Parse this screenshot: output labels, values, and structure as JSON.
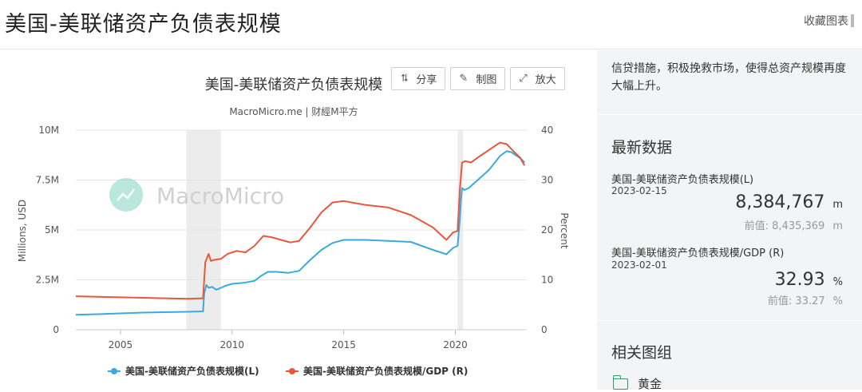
{
  "header": {
    "title": "美国-美联储资产负债表规模",
    "favorite_label": "收藏图表"
  },
  "toolbar": {
    "share_label": "分享",
    "draw_label": "制图",
    "zoom_label": "放大"
  },
  "watermark": "MacroMicro",
  "colors": {
    "series_l": "#3aa9dc",
    "series_r": "#e8573c",
    "recession": "#ececec"
  },
  "sidebar": {
    "intro_text": "信贷措施，积极挽救市场，使得总资产规模再度大幅上升。",
    "latest_title": "最新数据",
    "items": [
      {
        "name": "美国-美联储资产负债表规模(L)",
        "date": "2023-02-15",
        "value": "8,384,767",
        "unit": "m",
        "prev": "前值: 8,435,369",
        "prev_unit": "m"
      },
      {
        "name": "美国-美联储资产负债表规模/GDP (R)",
        "date": "2023-02-01",
        "value": "32.93",
        "unit": "%",
        "prev": "前值: 33.27",
        "prev_unit": "%"
      }
    ],
    "related_title": "相关图组",
    "related_item": "黄金"
  },
  "chart_data": {
    "type": "line",
    "title": "美国-美联储资产负债表规模",
    "subtitle": "MacroMicro.me | 财經M平方",
    "ylabel_left": "Millions, USD",
    "ylabel_right": "Percent",
    "xlim": [
      2003.0,
      2023.2
    ],
    "ylim_left": [
      0,
      10000000
    ],
    "ylim_right": [
      0,
      40
    ],
    "x_ticks": [
      2005,
      2010,
      2015,
      2020
    ],
    "x_tick_labels": [
      "2005",
      "2010",
      "2015",
      "2020"
    ],
    "y_left_ticks": [
      0,
      2500000,
      5000000,
      7500000,
      10000000
    ],
    "y_left_tick_labels": [
      "0",
      "2.5M",
      "5M",
      "7.5M",
      "10M"
    ],
    "y_right_ticks": [
      0,
      10,
      20,
      30,
      40
    ],
    "y_right_tick_labels": [
      "0",
      "10",
      "20",
      "30",
      "40"
    ],
    "grid": true,
    "legend_position": "bottom",
    "recessions": [
      [
        2007.95,
        2009.5
      ],
      [
        2020.1,
        2020.35
      ]
    ],
    "series": [
      {
        "name": "美国-美联储资产负债表规模(L)",
        "axis": "left",
        "x": [
          2003.0,
          2004.0,
          2005.0,
          2006.0,
          2007.0,
          2008.0,
          2008.7,
          2008.75,
          2008.85,
          2008.95,
          2009.1,
          2009.3,
          2009.5,
          2009.7,
          2010.0,
          2010.5,
          2011.0,
          2011.3,
          2011.6,
          2012.0,
          2012.5,
          2013.0,
          2013.5,
          2014.0,
          2014.5,
          2015.0,
          2016.0,
          2017.0,
          2018.0,
          2019.0,
          2019.6,
          2019.9,
          2020.1,
          2020.2,
          2020.25,
          2020.3,
          2020.4,
          2020.6,
          2021.0,
          2021.5,
          2022.0,
          2022.3,
          2022.5,
          2022.9,
          2023.1
        ],
        "values": [
          750000,
          780000,
          820000,
          860000,
          880000,
          900000,
          920000,
          1800000,
          2250000,
          2100000,
          2150000,
          2000000,
          2100000,
          2200000,
          2300000,
          2350000,
          2450000,
          2700000,
          2900000,
          2900000,
          2850000,
          2950000,
          3500000,
          4000000,
          4350000,
          4500000,
          4500000,
          4450000,
          4400000,
          4000000,
          3780000,
          4100000,
          4200000,
          5500000,
          6500000,
          7100000,
          7000000,
          7100000,
          7500000,
          8000000,
          8700000,
          8950000,
          8900000,
          8600000,
          8384767
        ]
      },
      {
        "name": "美国-美联储资产负债表规模/GDP (R)",
        "axis": "right",
        "x": [
          2003.0,
          2004.0,
          2005.0,
          2006.0,
          2007.0,
          2008.0,
          2008.7,
          2008.8,
          2008.95,
          2009.05,
          2009.2,
          2009.5,
          2009.8,
          2010.2,
          2010.6,
          2011.0,
          2011.4,
          2011.8,
          2012.2,
          2012.6,
          2013.0,
          2013.5,
          2014.0,
          2014.5,
          2015.0,
          2016.0,
          2017.0,
          2018.0,
          2019.0,
          2019.6,
          2019.9,
          2020.1,
          2020.2,
          2020.3,
          2020.45,
          2020.7,
          2021.0,
          2021.5,
          2022.0,
          2022.3,
          2022.6,
          2022.9,
          2023.1
        ],
        "values": [
          6.7,
          6.6,
          6.5,
          6.4,
          6.3,
          6.2,
          6.3,
          13.5,
          15.2,
          13.8,
          14.0,
          14.2,
          15.2,
          15.8,
          15.5,
          16.8,
          18.8,
          18.5,
          18.0,
          17.5,
          17.8,
          20.5,
          23.5,
          25.5,
          25.8,
          25.0,
          24.5,
          23.0,
          20.5,
          18.0,
          19.5,
          19.8,
          28.0,
          33.5,
          33.8,
          33.5,
          34.5,
          36.0,
          37.5,
          37.2,
          35.8,
          34.5,
          32.93
        ]
      }
    ]
  }
}
